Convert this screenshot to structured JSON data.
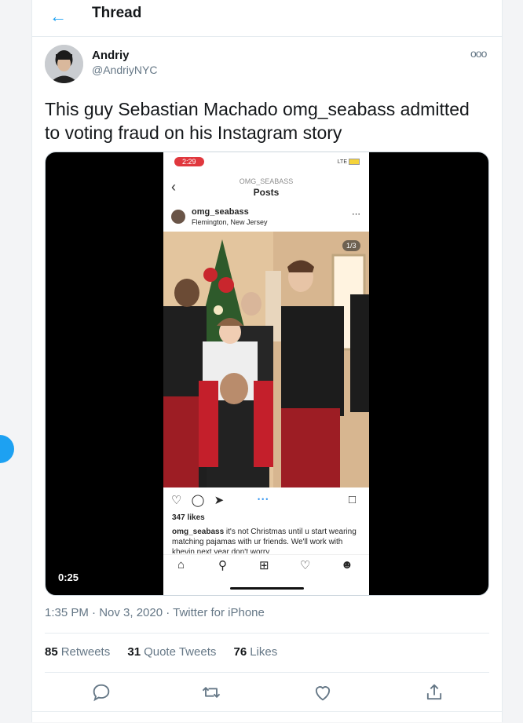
{
  "header": {
    "title": "Thread"
  },
  "tweet": {
    "author_name": "Andriy",
    "author_handle": "@AndriyNYC",
    "more_label": "ooo",
    "text": "This guy Sebastian Machado omg_seabass admitted to voting fraud on his Instagram story",
    "video_time": "0:25",
    "timestamp": "1:35 PM · Nov 3, 2020 · Twitter for iPhone",
    "retweets_count": "85",
    "retweets_label": "Retweets",
    "quotes_count": "31",
    "quotes_label": "Quote Tweets",
    "likes_count": "76",
    "likes_label": "Likes"
  },
  "instagram": {
    "status_time": "2:29",
    "signal": "LTE",
    "header_sub": "OMG_SEABASS",
    "header_title": "Posts",
    "username": "omg_seabass",
    "location": "Flemington, New Jersey",
    "photo_counter": "1/3",
    "likes": "347 likes",
    "caption_user": "omg_seabass",
    "caption_text": " it's not Christmas until u start wearing matching pajamas with ur friends. We'll work with khevin next year don't worry"
  },
  "icons": {
    "back": "arrow-left-icon",
    "reply": "reply-icon",
    "retweet": "retweet-icon",
    "like": "heart-icon",
    "share": "share-icon"
  },
  "colors": {
    "accent": "#1da1f2",
    "ig_red": "#e0383e"
  }
}
